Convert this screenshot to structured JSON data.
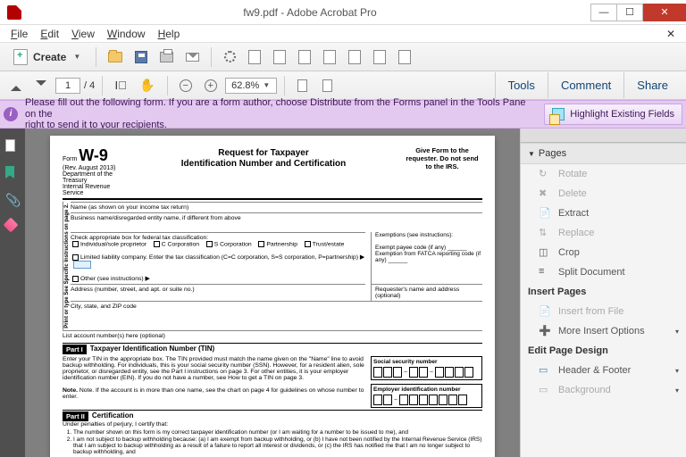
{
  "window": {
    "title": "fw9.pdf - Adobe Acrobat Pro"
  },
  "menu": {
    "file": "File",
    "edit": "Edit",
    "view": "View",
    "window": "Window",
    "help": "Help"
  },
  "toolbar": {
    "create": "Create"
  },
  "nav": {
    "page_current": "1",
    "page_total": "/ 4",
    "zoom": "62.8%",
    "tools": "Tools",
    "comment": "Comment",
    "share": "Share"
  },
  "formbar": {
    "msg_l1": "Please fill out the following form. If you are a form author, choose Distribute from the Forms panel in the Tools Pane on the",
    "msg_l2": "right to send it to your recipients.",
    "highlight": "Highlight Existing Fields"
  },
  "rpanel": {
    "pages": "Pages",
    "rotate": "Rotate",
    "delete": "Delete",
    "extract": "Extract",
    "replace": "Replace",
    "crop": "Crop",
    "split": "Split Document",
    "insert_pages": "Insert Pages",
    "insert_file": "Insert from File",
    "more_insert": "More Insert Options",
    "edit_design": "Edit Page Design",
    "header_footer": "Header & Footer",
    "background": "Background"
  },
  "doc": {
    "form_label": "Form",
    "form_no": "W-9",
    "rev": "(Rev. August 2013)",
    "dept1": "Department of the Treasury",
    "dept2": "Internal Revenue Service",
    "title_l1": "Request for Taxpayer",
    "title_l2": "Identification Number and Certification",
    "giveform": "Give Form to the requester. Do not send to the IRS.",
    "vert": "Print or type\nSee Specific Instructions on page 2.",
    "f_name": "Name (as shown on your income tax return)",
    "f_biz": "Business name/disregarded entity name, if different from above",
    "f_class": "Check appropriate box for federal tax classification:",
    "c_ind": "Individual/sole proprietor",
    "c_ccorp": "C Corporation",
    "c_scorp": "S Corporation",
    "c_part": "Partnership",
    "c_trust": "Trust/estate",
    "c_llc": "Limited liability company. Enter the tax classification (C=C corporation, S=S corporation, P=partnership) ▶",
    "c_other": "Other (see instructions) ▶",
    "exempt_h": "Exemptions (see instructions):",
    "exempt_payee": "Exempt payee code (if any)",
    "exempt_fatca": "Exemption from FATCA reporting code (if any)",
    "f_addr": "Address (number, street, and apt. or suite no.)",
    "f_reqaddr": "Requester's name and address (optional)",
    "f_city": "City, state, and ZIP code",
    "f_acct": "List account number(s) here (optional)",
    "part1": "Part I",
    "part1_t": "Taxpayer Identification Number (TIN)",
    "part1_body": "Enter your TIN in the appropriate box. The TIN provided must match the name given on the \"Name\" line to avoid backup withholding. For individuals, this is your social security number (SSN). However, for a resident alien, sole proprietor, or disregarded entity, see the Part I instructions on page 3. For other entities, it is your employer identification number (EIN). If you do not have a number, see How to get a TIN on page 3.",
    "part1_note": "Note. If the account is in more than one name, see the chart on page 4 for guidelines on whose number to enter.",
    "ssn_h": "Social security number",
    "ein_h": "Employer identification number",
    "part2": "Part II",
    "part2_t": "Certification",
    "cert_lead": "Under penalties of perjury, I certify that:",
    "cert1": "The number shown on this form is my correct taxpayer identification number (or I am waiting for a number to be issued to me), and",
    "cert2": "I am not subject to backup withholding because: (a) I am exempt from backup withholding, or (b) I have not been notified by the Internal Revenue Service (IRS) that I am subject to backup withholding as a result of a failure to report all interest or dividends, or (c) the IRS has notified me that I am no longer subject to backup withholding, and"
  }
}
